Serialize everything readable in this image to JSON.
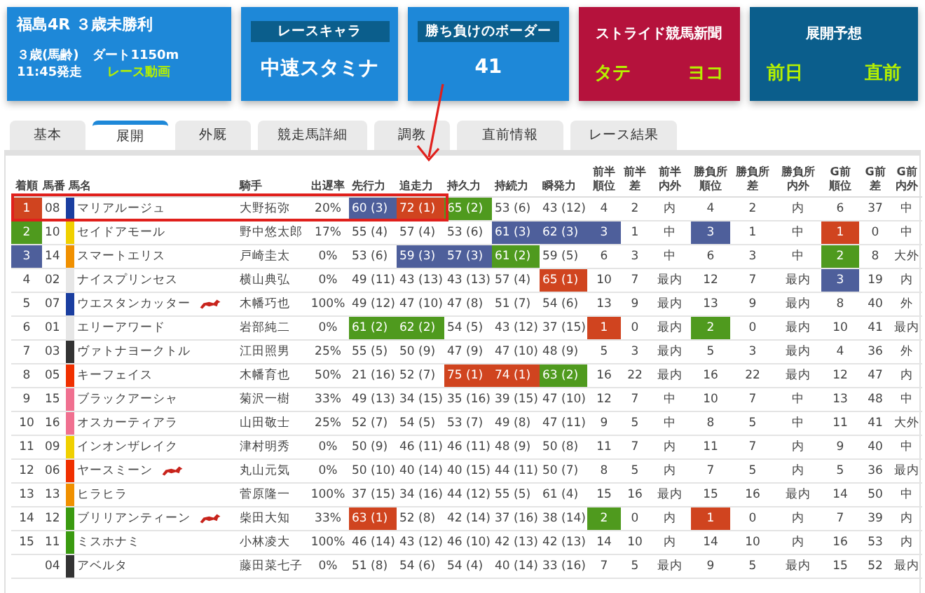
{
  "race": {
    "title": "福島4R ３歳未勝利",
    "age": "３歳(馬齢)",
    "course": "ダート1150m",
    "start": "11:45発走",
    "video_link": "レース動画"
  },
  "race_character": {
    "label": "レースキャラ",
    "value": "中速スタミナ"
  },
  "border": {
    "label": "勝ち負けのボーダー",
    "value": "41"
  },
  "newspaper": {
    "label": "ストライド競馬新聞",
    "links": [
      "タテ",
      "ヨコ"
    ]
  },
  "forecast": {
    "label": "展開予想",
    "links": [
      "前日",
      "直前"
    ]
  },
  "tabs": [
    {
      "label": "基本",
      "selected": false
    },
    {
      "label": "展開",
      "selected": true
    },
    {
      "label": "外厩",
      "selected": false
    },
    {
      "label": "競走馬詳細",
      "selected": false
    },
    {
      "label": "調教",
      "selected": false
    },
    {
      "label": "直前情報",
      "selected": false
    },
    {
      "label": "レース結果",
      "selected": false
    }
  ],
  "table": {
    "columns": [
      "着順",
      "馬番",
      "馬名",
      "騎手",
      "出遅率",
      "先行力",
      "追走力",
      "持久力",
      "持続力",
      "瞬発力",
      "前半順位",
      "前半差",
      "前半内外",
      "勝負所順位",
      "勝負所差",
      "勝負所内外",
      "G前順位",
      "G前差",
      "G前内外"
    ],
    "rows": [
      {
        "cells": [
          {
            "text": "1",
            "color": "#d0441f"
          },
          "08",
          "マリアルージュ",
          "大野拓弥",
          "20%",
          {
            "text": "60 (3)",
            "color": "#4e5f9b"
          },
          {
            "text": "72 (1)",
            "color": "#d0441f"
          },
          {
            "text": "65 (2)",
            "color": "#4f9a1e"
          },
          "53 (6)",
          "43 (12)",
          "4",
          "2",
          "内",
          "4",
          "2",
          "内",
          "6",
          "37",
          "中"
        ],
        "color": "#1a3ea0",
        "mark": false,
        "boxed": true
      },
      {
        "cells": [
          {
            "text": "2",
            "color": "#4f9a1e"
          },
          "10",
          "セイドアモール",
          "野中悠太郎",
          "17%",
          "55 (4)",
          "57 (4)",
          "53 (6)",
          {
            "text": "61 (3)",
            "color": "#4e5f9b"
          },
          {
            "text": "62 (3)",
            "color": "#4e5f9b"
          },
          {
            "text": "3",
            "color": "#4e5f9b"
          },
          "1",
          "中",
          {
            "text": "3",
            "color": "#4e5f9b"
          },
          "1",
          "中",
          {
            "text": "1",
            "color": "#d0441f"
          },
          "0",
          "中"
        ],
        "color": "#f0d000",
        "mark": false,
        "boxed": false
      },
      {
        "cells": [
          {
            "text": "3",
            "color": "#4e5f9b"
          },
          "14",
          "スマートエリス",
          "戸崎圭太",
          "0%",
          "53 (6)",
          {
            "text": "59 (3)",
            "color": "#4e5f9b"
          },
          {
            "text": "57 (3)",
            "color": "#4e5f9b"
          },
          {
            "text": "61 (2)",
            "color": "#4f9a1e"
          },
          "59 (5)",
          "6",
          "3",
          "中",
          "6",
          "3",
          "中",
          {
            "text": "2",
            "color": "#4f9a1e"
          },
          "8",
          "大外"
        ],
        "color": "#f09000",
        "mark": false,
        "boxed": false
      },
      {
        "cells": [
          "4",
          "02",
          "ナイスプリンセス",
          "横山典弘",
          "0%",
          "49 (11)",
          "43 (13)",
          "43 (13)",
          "57 (4)",
          {
            "text": "65 (1)",
            "color": "#d0441f"
          },
          "10",
          "7",
          "最内",
          "12",
          "7",
          "最内",
          {
            "text": "3",
            "color": "#4e5f9b"
          },
          "19",
          "内"
        ],
        "color": "#e6e6e6",
        "mark": false,
        "boxed": false
      },
      {
        "cells": [
          "5",
          "07",
          "ウエスタンカッター",
          "木幡巧也",
          "100%",
          "49 (12)",
          "47 (10)",
          "47 (8)",
          "51 (7)",
          "54 (6)",
          "13",
          "9",
          "最内",
          "13",
          "9",
          "最内",
          "8",
          "40",
          "外"
        ],
        "color": "#1a3ea0",
        "mark": true,
        "boxed": false
      },
      {
        "cells": [
          "6",
          "01",
          "エリーアワード",
          "岩部純二",
          "0%",
          {
            "text": "61 (2)",
            "color": "#4f9a1e"
          },
          {
            "text": "62 (2)",
            "color": "#4f9a1e"
          },
          "54 (5)",
          "43 (12)",
          "37 (15)",
          {
            "text": "1",
            "color": "#d0441f"
          },
          "0",
          "最内",
          {
            "text": "2",
            "color": "#4f9a1e"
          },
          "0",
          "最内",
          "10",
          "41",
          "最内"
        ],
        "color": "#e6e6e6",
        "mark": false,
        "boxed": false
      },
      {
        "cells": [
          "7",
          "03",
          "ヴァトナヨークトル",
          "江田照男",
          "25%",
          "55 (5)",
          "50 (9)",
          "47 (9)",
          "47 (10)",
          "48 (9)",
          "5",
          "3",
          "最内",
          "5",
          "3",
          "最内",
          "4",
          "36",
          "外"
        ],
        "color": "#333333",
        "mark": false,
        "boxed": false
      },
      {
        "cells": [
          "8",
          "05",
          "キーフェイス",
          "木幡育也",
          "50%",
          "21 (16)",
          "52 (7)",
          {
            "text": "75 (1)",
            "color": "#d0441f"
          },
          {
            "text": "74 (1)",
            "color": "#d0441f"
          },
          {
            "text": "63 (2)",
            "color": "#4f9a1e"
          },
          "16",
          "22",
          "最内",
          "16",
          "22",
          "最内",
          "12",
          "47",
          "内"
        ],
        "color": "#f03000",
        "mark": false,
        "boxed": false
      },
      {
        "cells": [
          "9",
          "15",
          "ブラックアーシャ",
          "菊沢一樹",
          "33%",
          "49 (13)",
          "34 (15)",
          "35 (16)",
          "39 (15)",
          "47 (10)",
          "12",
          "7",
          "中",
          "10",
          "7",
          "中",
          "13",
          "48",
          "中"
        ],
        "color": "#f07090",
        "mark": false,
        "boxed": false
      },
      {
        "cells": [
          "10",
          "16",
          "オスカーティアラ",
          "山田敬士",
          "25%",
          "52 (7)",
          "54 (5)",
          "53 (7)",
          "49 (8)",
          "47 (11)",
          "9",
          "5",
          "中",
          "8",
          "5",
          "中",
          "11",
          "41",
          "大外"
        ],
        "color": "#f07090",
        "mark": false,
        "boxed": false
      },
      {
        "cells": [
          "11",
          "09",
          "インオンザレイク",
          "津村明秀",
          "0%",
          "50 (9)",
          "46 (11)",
          "46 (11)",
          "48 (9)",
          "50 (8)",
          "11",
          "7",
          "内",
          "11",
          "7",
          "内",
          "9",
          "40",
          "中"
        ],
        "color": "#f0d000",
        "mark": false,
        "boxed": false
      },
      {
        "cells": [
          "12",
          "06",
          "ヤースミーン",
          "丸山元気",
          "0%",
          "50 (10)",
          "40 (14)",
          "40 (15)",
          "44 (11)",
          "50 (7)",
          "8",
          "5",
          "内",
          "7",
          "5",
          "内",
          "5",
          "36",
          "最内"
        ],
        "color": "#f03000",
        "mark": true,
        "boxed": false
      },
      {
        "cells": [
          "13",
          "13",
          "ヒラヒラ",
          "菅原隆一",
          "100%",
          "37 (15)",
          "34 (16)",
          "44 (12)",
          "55 (5)",
          "61 (4)",
          "15",
          "16",
          "最内",
          "15",
          "16",
          "最内",
          "14",
          "50",
          "中"
        ],
        "color": "#f09000",
        "mark": false,
        "boxed": false
      },
      {
        "cells": [
          "14",
          "12",
          "ブリリアンティーン",
          "柴田大知",
          "33%",
          {
            "text": "63 (1)",
            "color": "#d0441f"
          },
          "52 (8)",
          "42 (14)",
          "37 (16)",
          "38 (14)",
          {
            "text": "2",
            "color": "#4f9a1e"
          },
          "0",
          "内",
          {
            "text": "1",
            "color": "#d0441f"
          },
          "0",
          "内",
          "7",
          "39",
          "内"
        ],
        "color": "#3a9a10",
        "mark": true,
        "boxed": false
      },
      {
        "cells": [
          "15",
          "11",
          "ミスホナミ",
          "小林凌大",
          "100%",
          "46 (14)",
          "43 (12)",
          "46 (10)",
          "42 (13)",
          "42 (13)",
          "14",
          "10",
          "内",
          "14",
          "10",
          "内",
          "16",
          "53",
          "内"
        ],
        "color": "#3a9a10",
        "mark": false,
        "boxed": false
      },
      {
        "cells": [
          "",
          "04",
          "アベルタ",
          "藤田菜七子",
          "0%",
          "51 (8)",
          "54 (6)",
          "54 (4)",
          "40 (14)",
          "33 (16)",
          "7",
          "5",
          "最内",
          "9",
          "5",
          "最内",
          "15",
          "52",
          "最内"
        ],
        "color": "#333333",
        "mark": false,
        "boxed": false
      }
    ]
  }
}
